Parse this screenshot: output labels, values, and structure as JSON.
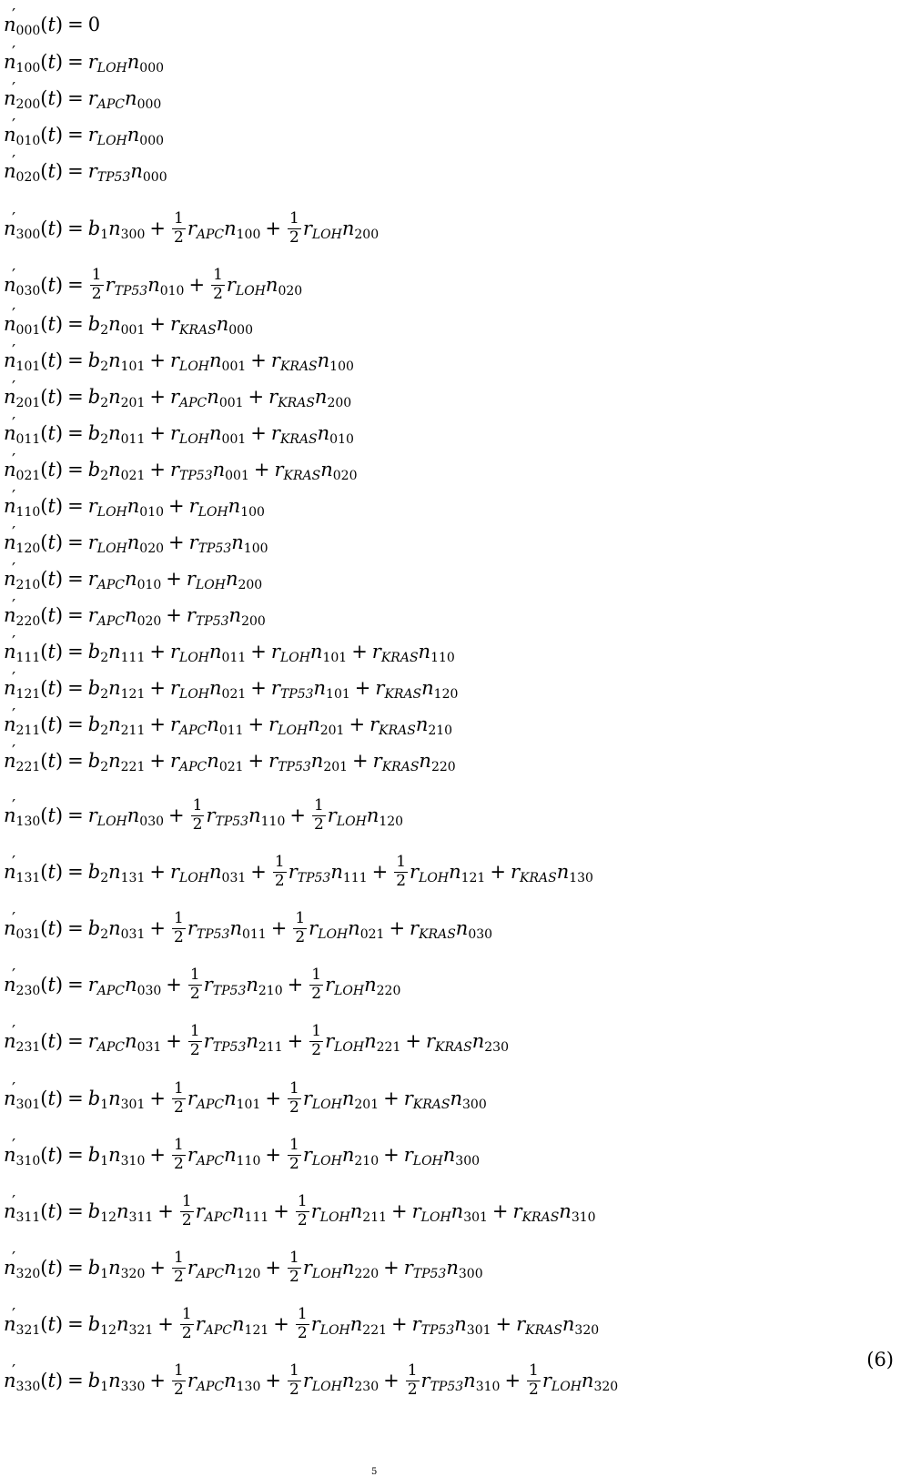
{
  "equations": [
    {
      "lhs": "000",
      "terms": [
        {
          "lit": "0"
        }
      ]
    },
    {
      "lhs": "100",
      "terms": [
        {
          "r": "LOH",
          "n": "000"
        }
      ]
    },
    {
      "lhs": "200",
      "terms": [
        {
          "r": "APC",
          "n": "000"
        }
      ]
    },
    {
      "lhs": "010",
      "terms": [
        {
          "r": "LOH",
          "n": "000"
        }
      ]
    },
    {
      "lhs": "020",
      "terms": [
        {
          "r": "TP53",
          "n": "000"
        }
      ]
    },
    {
      "lhs": "300",
      "terms": [
        {
          "b": "1",
          "n": "300"
        },
        {
          "half": true,
          "r": "APC",
          "n": "100"
        },
        {
          "half": true,
          "r": "LOH",
          "n": "200"
        }
      ]
    },
    {
      "lhs": "030",
      "terms": [
        {
          "half": true,
          "r": "TP53",
          "n": "010"
        },
        {
          "half": true,
          "r": "LOH",
          "n": "020"
        }
      ]
    },
    {
      "lhs": "001",
      "terms": [
        {
          "b": "2",
          "n": "001"
        },
        {
          "r": "KRAS",
          "n": "000"
        }
      ]
    },
    {
      "lhs": "101",
      "terms": [
        {
          "b": "2",
          "n": "101"
        },
        {
          "r": "LOH",
          "n": "001"
        },
        {
          "r": "KRAS",
          "n": "100"
        }
      ]
    },
    {
      "lhs": "201",
      "terms": [
        {
          "b": "2",
          "n": "201"
        },
        {
          "r": "APC",
          "n": "001"
        },
        {
          "r": "KRAS",
          "n": "200"
        }
      ]
    },
    {
      "lhs": "011",
      "terms": [
        {
          "b": "2",
          "n": "011"
        },
        {
          "r": "LOH",
          "n": "001"
        },
        {
          "r": "KRAS",
          "n": "010"
        }
      ]
    },
    {
      "lhs": "021",
      "terms": [
        {
          "b": "2",
          "n": "021"
        },
        {
          "r": "TP53",
          "n": "001"
        },
        {
          "r": "KRAS",
          "n": "020"
        }
      ]
    },
    {
      "lhs": "110",
      "terms": [
        {
          "r": "LOH",
          "n": "010"
        },
        {
          "r": "LOH",
          "n": "100"
        }
      ]
    },
    {
      "lhs": "120",
      "terms": [
        {
          "r": "LOH",
          "n": "020"
        },
        {
          "r": "TP53",
          "n": "100"
        }
      ]
    },
    {
      "lhs": "210",
      "terms": [
        {
          "r": "APC",
          "n": "010"
        },
        {
          "r": "LOH",
          "n": "200"
        }
      ]
    },
    {
      "lhs": "220",
      "terms": [
        {
          "r": "APC",
          "n": "020"
        },
        {
          "r": "TP53",
          "n": "200"
        }
      ]
    },
    {
      "lhs": "111",
      "terms": [
        {
          "b": "2",
          "n": "111"
        },
        {
          "r": "LOH",
          "n": "011"
        },
        {
          "r": "LOH",
          "n": "101"
        },
        {
          "r": "KRAS",
          "n": "110"
        }
      ]
    },
    {
      "lhs": "121",
      "terms": [
        {
          "b": "2",
          "n": "121"
        },
        {
          "r": "LOH",
          "n": "021"
        },
        {
          "r": "TP53",
          "n": "101"
        },
        {
          "r": "KRAS",
          "n": "120"
        }
      ]
    },
    {
      "lhs": "211",
      "terms": [
        {
          "b": "2",
          "n": "211"
        },
        {
          "r": "APC",
          "n": "011"
        },
        {
          "r": "LOH",
          "n": "201"
        },
        {
          "r": "KRAS",
          "n": "210"
        }
      ]
    },
    {
      "lhs": "221",
      "terms": [
        {
          "b": "2",
          "n": "221"
        },
        {
          "r": "APC",
          "n": "021"
        },
        {
          "r": "TP53",
          "n": "201"
        },
        {
          "r": "KRAS",
          "n": "220"
        }
      ]
    },
    {
      "lhs": "130",
      "terms": [
        {
          "r": "LOH",
          "n": "030"
        },
        {
          "half": true,
          "r": "TP53",
          "n": "110"
        },
        {
          "half": true,
          "r": "LOH",
          "n": "120"
        }
      ]
    },
    {
      "lhs": "131",
      "terms": [
        {
          "b": "2",
          "n": "131"
        },
        {
          "r": "LOH",
          "n": "031"
        },
        {
          "half": true,
          "r": "TP53",
          "n": "111"
        },
        {
          "half": true,
          "r": "LOH",
          "n": "121"
        },
        {
          "r": "KRAS",
          "n": "130"
        }
      ]
    },
    {
      "lhs": "031",
      "terms": [
        {
          "b": "2",
          "n": "031"
        },
        {
          "half": true,
          "r": "TP53",
          "n": "011"
        },
        {
          "half": true,
          "r": "LOH",
          "n": "021"
        },
        {
          "r": "KRAS",
          "n": "030"
        }
      ]
    },
    {
      "lhs": "230",
      "terms": [
        {
          "r": "APC",
          "n": "030"
        },
        {
          "half": true,
          "r": "TP53",
          "n": "210"
        },
        {
          "half": true,
          "r": "LOH",
          "n": "220"
        }
      ]
    },
    {
      "lhs": "231",
      "terms": [
        {
          "r": "APC",
          "n": "031"
        },
        {
          "half": true,
          "r": "TP53",
          "n": "211"
        },
        {
          "half": true,
          "r": "LOH",
          "n": "221"
        },
        {
          "r": "KRAS",
          "n": "230"
        }
      ]
    },
    {
      "lhs": "301",
      "terms": [
        {
          "b": "1",
          "n": "301"
        },
        {
          "half": true,
          "r": "APC",
          "n": "101"
        },
        {
          "half": true,
          "r": "LOH",
          "n": "201"
        },
        {
          "r": "KRAS",
          "n": "300"
        }
      ]
    },
    {
      "lhs": "310",
      "terms": [
        {
          "b": "1",
          "n": "310"
        },
        {
          "half": true,
          "r": "APC",
          "n": "110"
        },
        {
          "half": true,
          "r": "LOH",
          "n": "210"
        },
        {
          "r": "LOH",
          "n": "300"
        }
      ]
    },
    {
      "lhs": "311",
      "terms": [
        {
          "b": "12",
          "n": "311"
        },
        {
          "half": true,
          "r": "APC",
          "n": "111"
        },
        {
          "half": true,
          "r": "LOH",
          "n": "211"
        },
        {
          "r": "LOH",
          "n": "301"
        },
        {
          "r": "KRAS",
          "n": "310"
        }
      ]
    },
    {
      "lhs": "320",
      "terms": [
        {
          "b": "1",
          "n": "320"
        },
        {
          "half": true,
          "r": "APC",
          "n": "120"
        },
        {
          "half": true,
          "r": "LOH",
          "n": "220"
        },
        {
          "r": "TP53",
          "n": "300"
        }
      ]
    },
    {
      "lhs": "321",
      "terms": [
        {
          "b": "12",
          "n": "321"
        },
        {
          "half": true,
          "r": "APC",
          "n": "121"
        },
        {
          "half": true,
          "r": "LOH",
          "n": "221"
        },
        {
          "r": "TP53",
          "n": "301"
        },
        {
          "r": "KRAS",
          "n": "320"
        }
      ]
    },
    {
      "lhs": "330",
      "terms": [
        {
          "b": "1",
          "n": "330"
        },
        {
          "half": true,
          "r": "APC",
          "n": "130"
        },
        {
          "half": true,
          "r": "LOH",
          "n": "230"
        },
        {
          "half": true,
          "r": "TP53",
          "n": "310"
        },
        {
          "half": true,
          "r": "LOH",
          "n": "320"
        }
      ]
    }
  ],
  "equation_number": "(6)",
  "page_number": "5"
}
